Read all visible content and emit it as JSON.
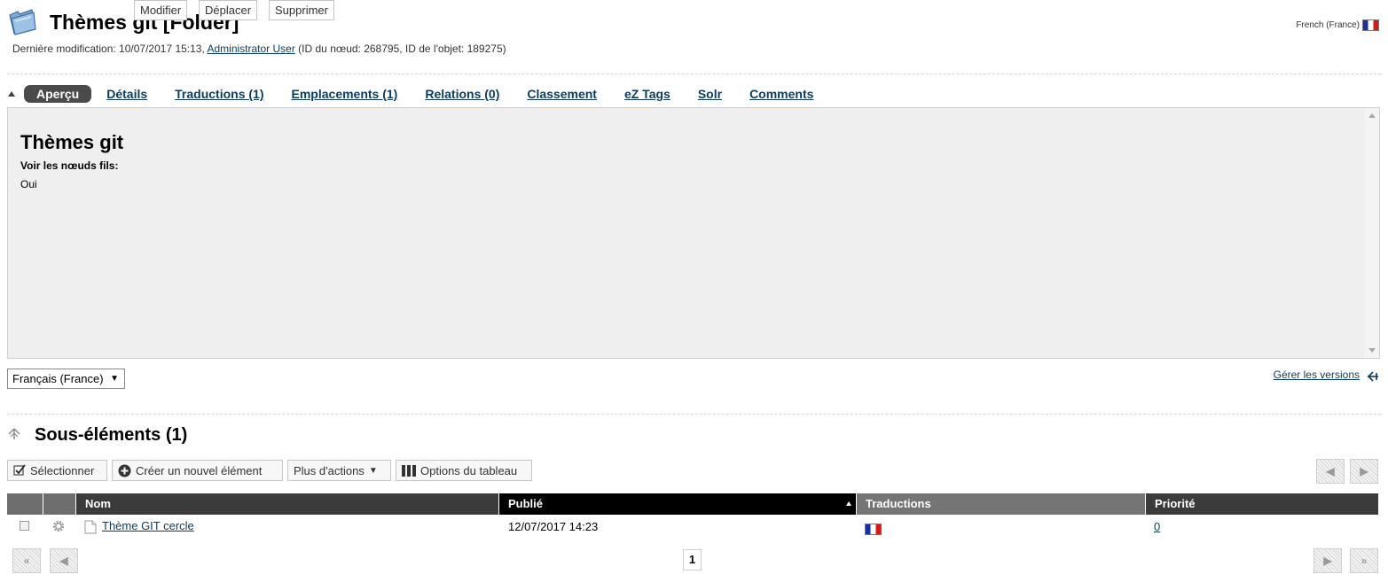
{
  "header": {
    "title": "Thèmes git [Folder]",
    "meta_prefix": "Dernière modification: 10/07/2017 15:13, ",
    "author": "Administrator User",
    "meta_suffix": " (ID du nœud: 268795, ID de l'objet: 189275)",
    "language": "French (France)"
  },
  "tabs": [
    {
      "label": "Aperçu"
    },
    {
      "label": "Détails"
    },
    {
      "label": "Traductions (1)"
    },
    {
      "label": "Emplacements (1)"
    },
    {
      "label": "Relations (0)"
    },
    {
      "label": "Classement"
    },
    {
      "label": "eZ Tags"
    },
    {
      "label": "Solr"
    },
    {
      "label": "Comments"
    }
  ],
  "preview": {
    "title": "Thèmes git",
    "field_label": "Voir les nœuds fils:",
    "field_value": "Oui"
  },
  "actions": {
    "language_selected": "Français (France)",
    "edit": "Modifier",
    "move": "Déplacer",
    "delete": "Supprimer",
    "versions": "Gérer les versions"
  },
  "subitems": {
    "title": "Sous-éléments (1)",
    "toolbar": {
      "select": "Sélectionner",
      "create": "Créer un nouvel élément",
      "more": "Plus d'actions",
      "table_options": "Options du tableau"
    },
    "columns": {
      "name": "Nom",
      "published": "Publié",
      "translations": "Traductions",
      "priority": "Priorité"
    },
    "rows": [
      {
        "name": "Thème GIT cercle",
        "published": "12/07/2017 14:23",
        "priority": "0"
      }
    ],
    "page": "1"
  }
}
